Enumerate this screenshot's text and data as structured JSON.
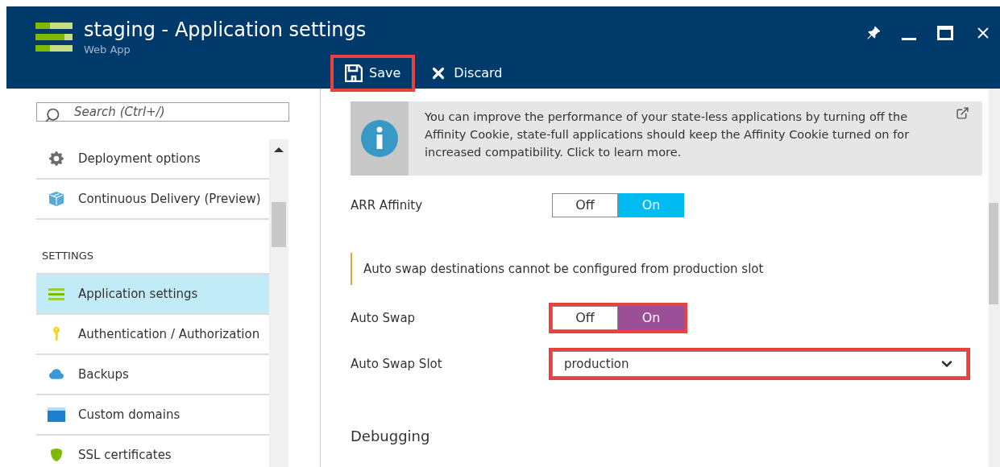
{
  "window": {
    "title": "staging - Application settings",
    "subtitle": "Web App"
  },
  "toolbar": [
    {
      "kind": "save",
      "label": "Save",
      "highlighted": true
    },
    {
      "kind": "discard",
      "label": "Discard",
      "highlighted": false
    }
  ],
  "sidebar": {
    "search": {
      "placeholder": "Search (Ctrl+/)"
    },
    "items": [
      {
        "kind": "item",
        "label": "Deployment options",
        "selected": false
      },
      {
        "kind": "item",
        "label": "Continuous Delivery (Preview)",
        "selected": false
      },
      {
        "kind": "heading",
        "label": "SETTINGS"
      },
      {
        "kind": "item",
        "label": "Application settings",
        "selected": true
      },
      {
        "kind": "item",
        "label": "Authentication / Authorization",
        "selected": false
      },
      {
        "kind": "item",
        "label": "Backups",
        "selected": false
      },
      {
        "kind": "item",
        "label": "Custom domains",
        "selected": false
      },
      {
        "kind": "item",
        "label": "SSL certificates",
        "selected": false
      }
    ]
  },
  "info_banner": {
    "text": "You can improve the performance of your state-less applications by turning off the Affinity Cookie, state-full applications should keep the Affinity Cookie turned on for increased compatibility. Click to learn more."
  },
  "settings": [
    {
      "kind": "toggle",
      "label": "ARR Affinity",
      "off_label": "Off",
      "on_label": "On",
      "on": true,
      "color": "#00bcf2",
      "highlighted": false
    },
    {
      "kind": "note",
      "text": "Auto swap destinations cannot be configured from production slot"
    },
    {
      "kind": "toggle",
      "label": "Auto Swap",
      "off_label": "Off",
      "on_label": "On",
      "on": true,
      "color": "#9b4f96",
      "highlighted": true
    },
    {
      "kind": "select",
      "label": "Auto Swap Slot",
      "value": "production",
      "highlighted": true
    },
    {
      "kind": "heading",
      "label": "Debugging"
    }
  ]
}
